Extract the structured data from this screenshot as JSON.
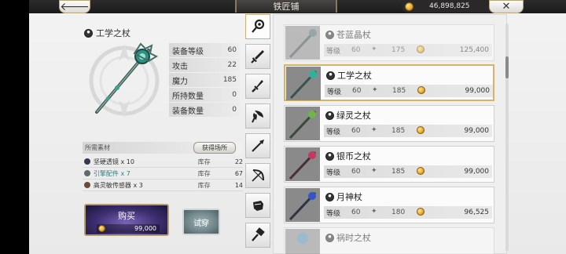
{
  "header": {
    "title": "铁匠铺",
    "currency": "46,898,825"
  },
  "selected_item": {
    "name": "工学之杖",
    "stats": [
      {
        "label": "装备等级",
        "value": "60"
      },
      {
        "label": "攻击",
        "value": "22"
      },
      {
        "label": "魔力",
        "value": "185"
      },
      {
        "label": "所持数量",
        "value": "0"
      },
      {
        "label": "装备数量",
        "value": "0"
      }
    ]
  },
  "materials": {
    "header": "所需素材",
    "source_button": "获得场所",
    "items": [
      {
        "name": "坚硬透镜 x 10",
        "stock_label": "库存",
        "count": "22",
        "color": "#2f3a55",
        "text_color": "#333333"
      },
      {
        "name": "引擎配件 x 7",
        "stock_label": "库存",
        "count": "67",
        "color": "#5d6b70",
        "text_color": "#2a7f86"
      },
      {
        "name": "高灵敏传感器 x 3",
        "stock_label": "库存",
        "count": "14",
        "color": "#6a4a38",
        "text_color": "#333333"
      }
    ]
  },
  "buttons": {
    "buy_label": "购买",
    "buy_price": "99,000",
    "try_label": "试穿"
  },
  "tabs": [
    {
      "icon": "staff-icon",
      "active": true
    },
    {
      "icon": "sword-icon",
      "active": false
    },
    {
      "icon": "dagger-icon",
      "active": false
    },
    {
      "icon": "axe-icon",
      "active": false
    },
    {
      "icon": "spear-icon",
      "active": false
    },
    {
      "icon": "bow-icon",
      "active": false
    },
    {
      "icon": "gauntlet-icon",
      "active": false
    },
    {
      "icon": "hammer-icon",
      "active": false
    }
  ],
  "list": {
    "level_label": "等级",
    "items": [
      {
        "name": "苍蓝晶杖",
        "level": "60",
        "power": "175",
        "price": "125,400",
        "state": "dim",
        "gem": "#4d6e73"
      },
      {
        "name": "工学之杖",
        "level": "60",
        "power": "185",
        "price": "99,000",
        "state": "selected",
        "gem": "#2bb3a0"
      },
      {
        "name": "绿灵之杖",
        "level": "60",
        "power": "185",
        "price": "99,000",
        "state": "normal",
        "gem": "#6fb54a"
      },
      {
        "name": "银币之杖",
        "level": "60",
        "power": "185",
        "price": "99,000",
        "state": "normal",
        "gem": "#c23a62"
      },
      {
        "name": "月神杖",
        "level": "60",
        "power": "180",
        "price": "96,525",
        "state": "normal",
        "gem": "#3355c7"
      },
      {
        "name": "祸时之杖",
        "level": "",
        "power": "",
        "price": "",
        "state": "dim",
        "gem": "#5a8fb3"
      }
    ]
  }
}
